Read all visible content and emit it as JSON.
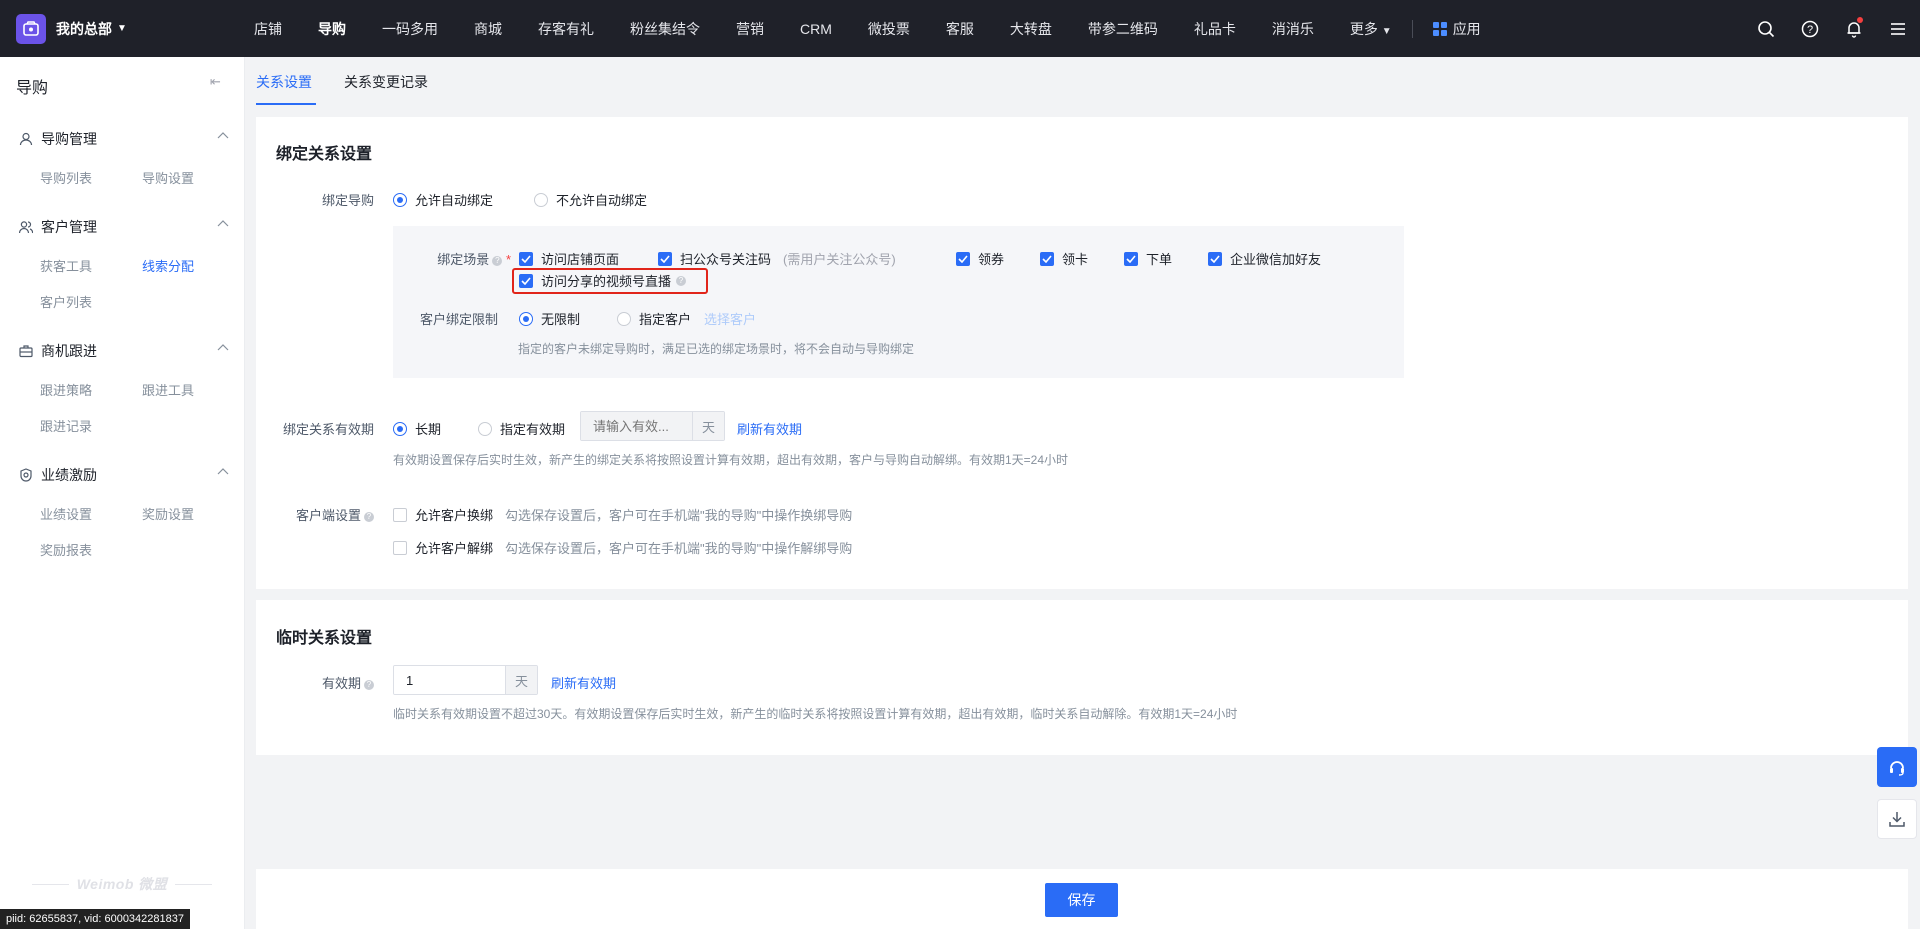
{
  "topbar": {
    "brand": "我的总部",
    "nav": [
      "店铺",
      "导购",
      "一码多用",
      "商城",
      "存客有礼",
      "粉丝集结令",
      "营销",
      "CRM",
      "微投票",
      "客服",
      "大转盘",
      "带参二维码",
      "礼品卡",
      "消消乐",
      "更多"
    ],
    "active_nav": "导购",
    "apps_label": "应用",
    "icons": [
      "search-icon",
      "help-icon",
      "bell-icon",
      "menu-icon"
    ]
  },
  "sidebar": {
    "title": "导购",
    "groups": [
      {
        "label": "导购管理",
        "icon": "user-icon",
        "items": [
          "导购列表",
          "导购设置"
        ]
      },
      {
        "label": "客户管理",
        "icon": "users-icon",
        "items": [
          "获客工具",
          "线索分配",
          "客户列表"
        ]
      },
      {
        "label": "商机跟进",
        "icon": "briefcase-icon",
        "items": [
          "跟进策略",
          "跟进工具",
          "跟进记录"
        ]
      },
      {
        "label": "业绩激励",
        "icon": "award-icon",
        "items": [
          "业绩设置",
          "奖励设置",
          "奖励报表"
        ]
      }
    ],
    "active_item": "线索分配",
    "footer_logo": "Weimob 微盟"
  },
  "tabs": [
    "关系设置",
    "关系变更记录"
  ],
  "active_tab": "关系设置",
  "bind_section": {
    "title": "绑定关系设置",
    "bind_guide": {
      "label": "绑定导购",
      "options": [
        "允许自动绑定",
        "不允许自动绑定"
      ],
      "selected": "允许自动绑定"
    },
    "scene": {
      "label": "绑定场景",
      "required_mark": "*",
      "checks": [
        {
          "label": "访问店铺页面",
          "checked": true
        },
        {
          "label": "扫公众号关注码",
          "note": "(需用户关注公众号)",
          "checked": true
        },
        {
          "label": "领券",
          "checked": true
        },
        {
          "label": "领卡",
          "checked": true
        },
        {
          "label": "下单",
          "checked": true
        },
        {
          "label": "企业微信加好友",
          "checked": true
        },
        {
          "label": "访问分享的视频号直播",
          "checked": true
        }
      ]
    },
    "customer_limit": {
      "label": "客户绑定限制",
      "options": [
        "无限制",
        "指定客户"
      ],
      "selected": "无限制",
      "select_link": "选择客户",
      "hint": "指定的客户未绑定导购时，满足已选的绑定场景时，将不会自动与导购绑定"
    },
    "validity": {
      "label": "绑定关系有效期",
      "options": [
        "长期",
        "指定有效期"
      ],
      "selected": "长期",
      "input_placeholder": "请输入有效...",
      "unit": "天",
      "refresh_link": "刷新有效期",
      "hint": "有效期设置保存后实时生效，新产生的绑定关系将按照设置计算有效期，超出有效期，客户与导购自动解绑。有效期1天=24小时"
    },
    "client_settings": {
      "label": "客户端设置",
      "checks": [
        {
          "label": "允许客户换绑",
          "desc": "勾选保存设置后，客户可在手机端\"我的导购\"中操作换绑导购",
          "checked": false
        },
        {
          "label": "允许客户解绑",
          "desc": "勾选保存设置后，客户可在手机端\"我的导购\"中操作解绑导购",
          "checked": false
        }
      ]
    }
  },
  "temp_section": {
    "title": "临时关系设置",
    "validity": {
      "label": "有效期",
      "value": "1",
      "unit": "天",
      "refresh_link": "刷新有效期",
      "hint": "临时关系有效期设置不超过30天。有效期设置保存后实时生效，新产生的临时关系将按照设置计算有效期，超出有效期，临时关系自动解除。有效期1天=24小时"
    }
  },
  "footer": {
    "save_label": "保存"
  },
  "debug": {
    "piid": "piid: 62655837, vid: 6000342281837"
  },
  "colors": {
    "primary": "#2a6cf6",
    "topbar": "#1f2129",
    "highlight": "#e1251b"
  }
}
